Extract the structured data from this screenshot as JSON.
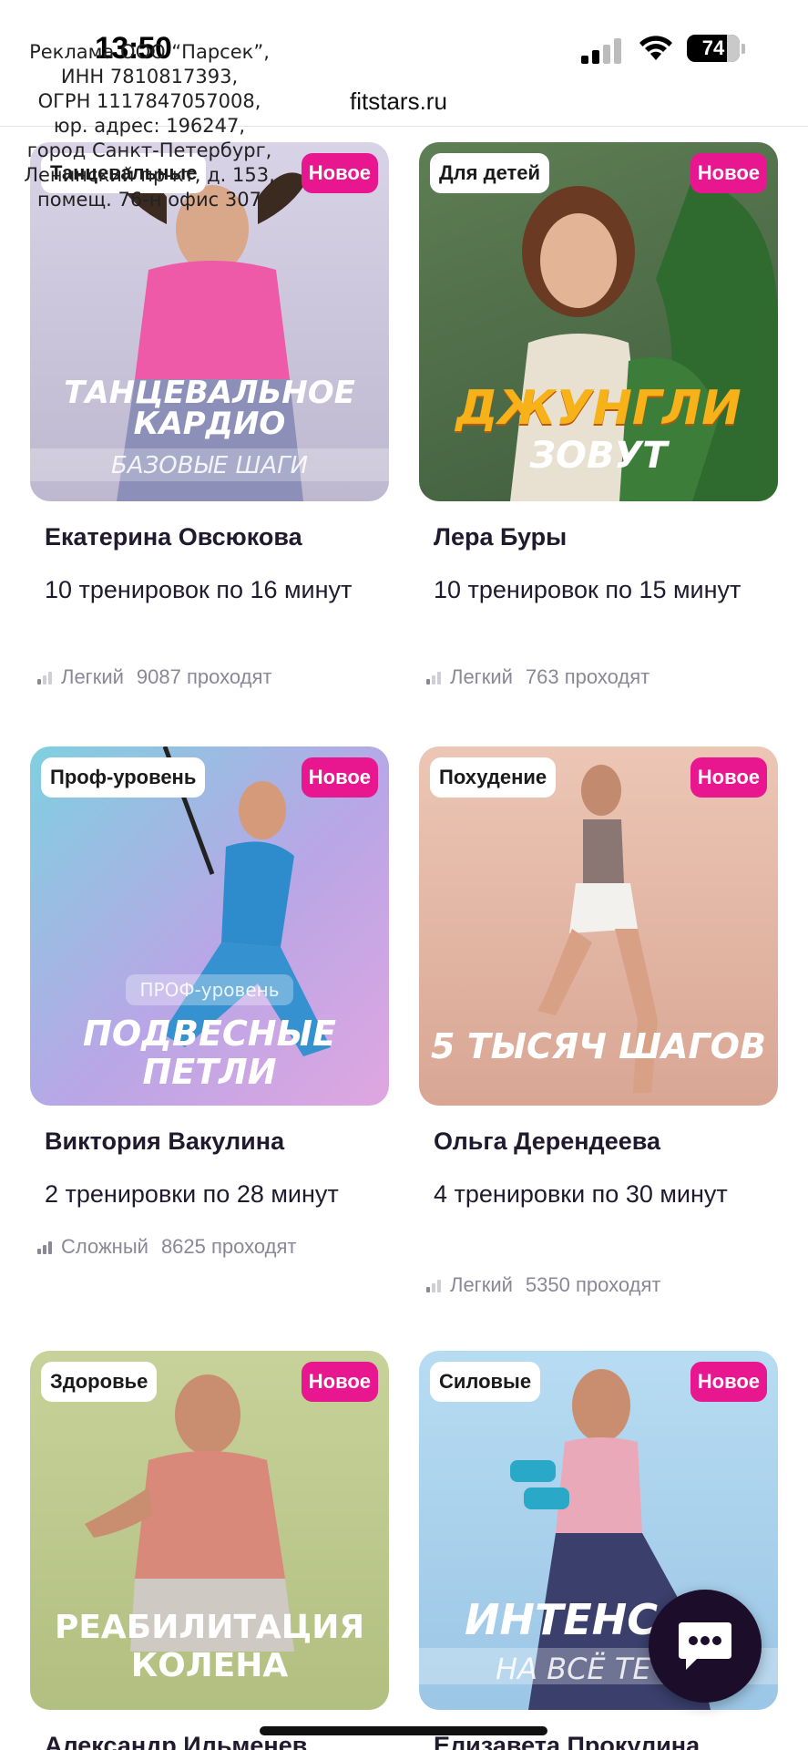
{
  "status_bar": {
    "time": "13:50",
    "battery": "74"
  },
  "browser": {
    "url": "fitstars.ru"
  },
  "ad_disclaimer": [
    "Реклама ООО “Парсек”,",
    "ИНН 7810817393,",
    "ОГРН 1117847057008,",
    "юр. адрес: 196247,",
    "город Санкт-Петербург,",
    "Ленинский пр-кт, д. 153,",
    "помещ. 76-н офис 307"
  ],
  "cards": [
    {
      "category": "Танцевальные",
      "new_label": "Новое",
      "poster_title_1": "Танцевальное",
      "poster_title_2": "кардио",
      "poster_sub": "Базовые шаги",
      "author": "Екатерина Овсюкова",
      "workouts": "10 тренировок по 16 минут",
      "level": "Легкий",
      "level_bars": 1,
      "participants": "9087 проходят",
      "bg": "#c9c5d9"
    },
    {
      "category": "Для детей",
      "new_label": "Новое",
      "poster_title_1": "Джунгли",
      "poster_title_2": "зовут",
      "author": "Лера Буры",
      "workouts": "10 тренировок по 15 минут",
      "level": "Легкий",
      "level_bars": 1,
      "participants": "763 проходят",
      "bg": "#4f6f48"
    },
    {
      "category": "Проф-уровень",
      "new_label": "Новое",
      "poster_chip": "ПРОФ-уровень",
      "poster_title_1": "Подвесные",
      "poster_title_2": "петли",
      "author": "Виктория Вакулина",
      "workouts": "2 тренировки по 28 минут",
      "level": "Сложный",
      "level_bars": 3,
      "participants": "8625 проходят",
      "bg": "#b6a4dc"
    },
    {
      "category": "Похудение",
      "new_label": "Новое",
      "poster_title_1": "5 тысяч шагов",
      "author": "Ольга Дерендеева",
      "workouts": "4 тренировки по 30 минут",
      "level": "Легкий",
      "level_bars": 1,
      "participants": "5350 проходят",
      "bg": "#e2b8a6"
    },
    {
      "category": "Здоровье",
      "new_label": "Новое",
      "poster_title_1": "Реабилитация",
      "poster_title_2": "колена",
      "author": "Александр Ильменев",
      "bg": "#bcc98c"
    },
    {
      "category": "Силовые",
      "new_label": "Новое",
      "poster_title_1": "Интенс",
      "poster_sub": "на всё те",
      "author": "Елизавета Прокулина",
      "bg": "#a8cde8"
    }
  ],
  "icons": {
    "chat": "chat-bubble-icon",
    "level": "signal-bars-icon"
  },
  "colors": {
    "new_badge": "#e8178f",
    "chat_fab": "#1c0d2b"
  }
}
